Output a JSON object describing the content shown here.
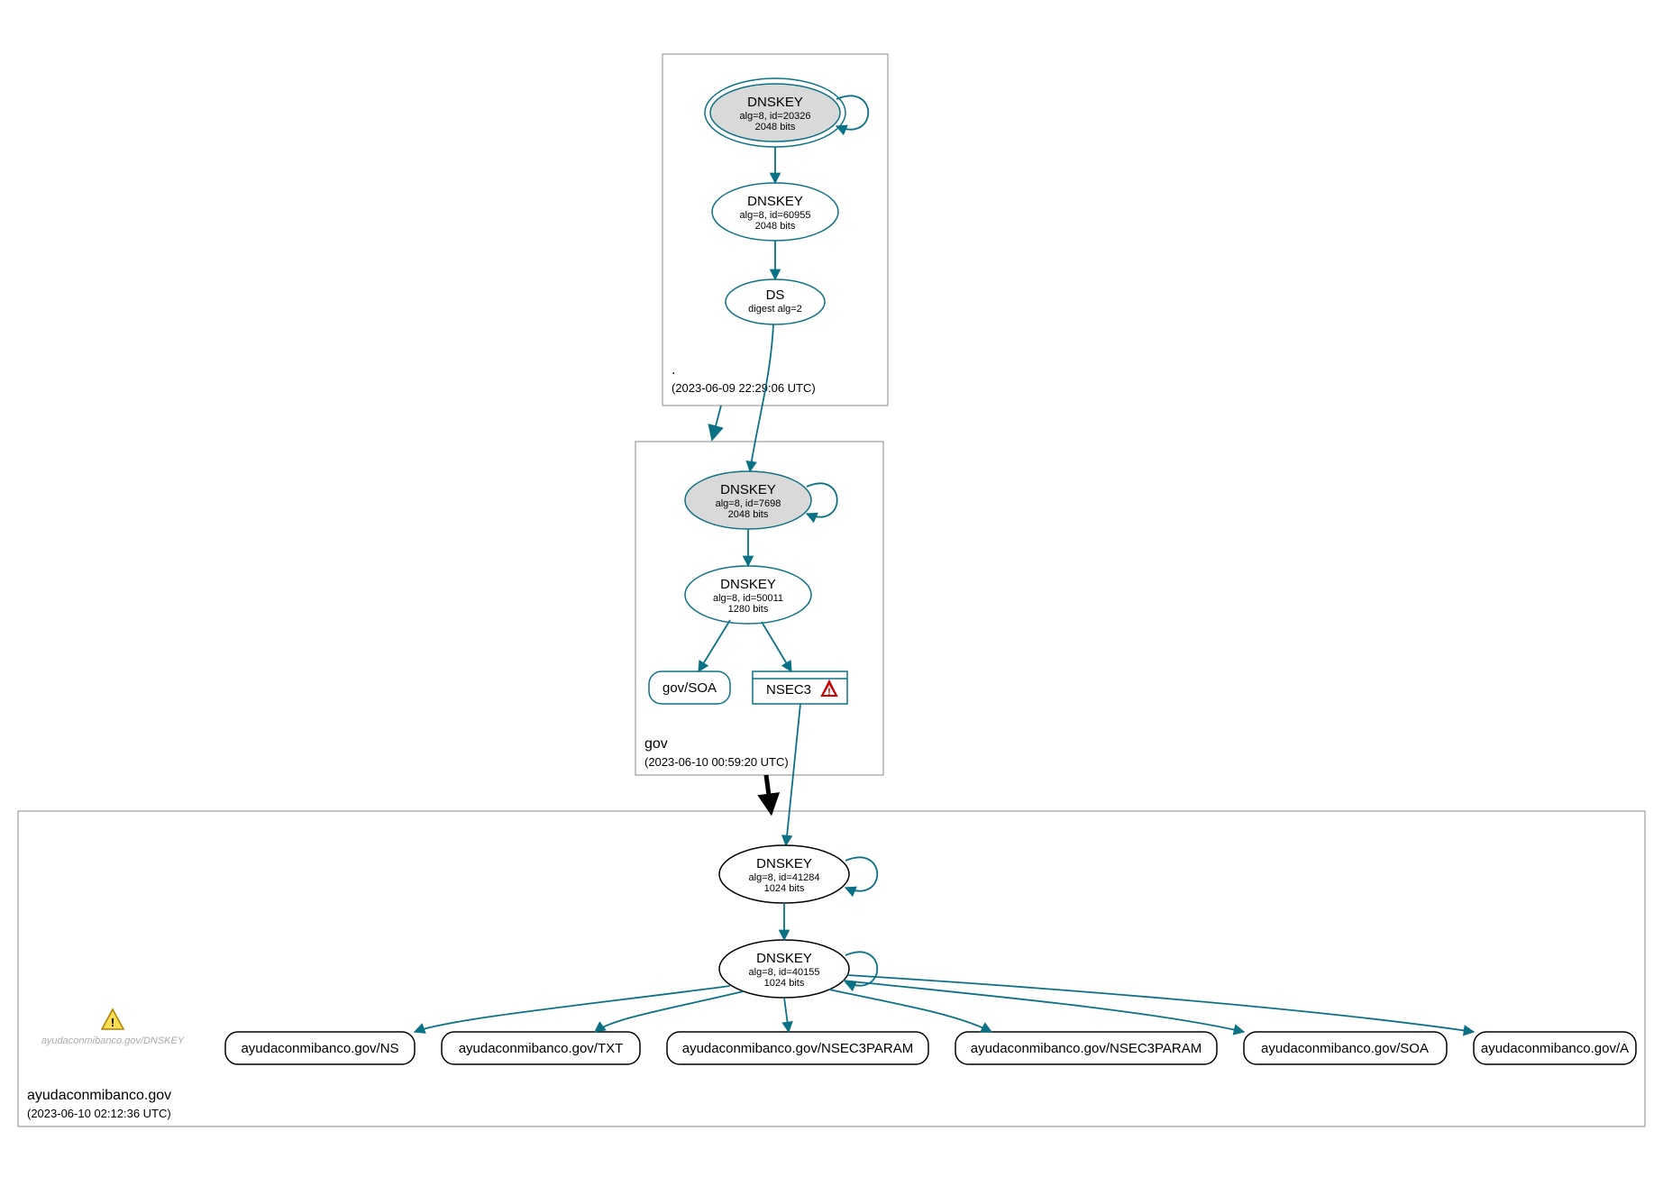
{
  "zones": {
    "root": {
      "name": ".",
      "timestamp": "(2023-06-09 22:29:06 UTC)"
    },
    "gov": {
      "name": "gov",
      "timestamp": "(2023-06-10 00:59:20 UTC)"
    },
    "domain": {
      "name": "ayudaconmibanco.gov",
      "timestamp": "(2023-06-10 02:12:36 UTC)"
    }
  },
  "nodes": {
    "root_ksk": {
      "title": "DNSKEY",
      "line2": "alg=8, id=20326",
      "line3": "2048 bits"
    },
    "root_zsk": {
      "title": "DNSKEY",
      "line2": "alg=8, id=60955",
      "line3": "2048 bits"
    },
    "root_ds": {
      "title": "DS",
      "line2": "digest alg=2"
    },
    "gov_ksk": {
      "title": "DNSKEY",
      "line2": "alg=8, id=7698",
      "line3": "2048 bits"
    },
    "gov_zsk": {
      "title": "DNSKEY",
      "line2": "alg=8, id=50011",
      "line3": "1280 bits"
    },
    "gov_soa": {
      "label": "gov/SOA"
    },
    "gov_nsec3": {
      "label": "NSEC3"
    },
    "dom_ksk": {
      "title": "DNSKEY",
      "line2": "alg=8, id=41284",
      "line3": "1024 bits"
    },
    "dom_zsk": {
      "title": "DNSKEY",
      "line2": "alg=8, id=40155",
      "line3": "1024 bits"
    },
    "dom_warn": {
      "label": "ayudaconmibanco.gov/DNSKEY"
    },
    "rr_ns": {
      "label": "ayudaconmibanco.gov/NS"
    },
    "rr_txt": {
      "label": "ayudaconmibanco.gov/TXT"
    },
    "rr_n3p1": {
      "label": "ayudaconmibanco.gov/NSEC3PARAM"
    },
    "rr_n3p2": {
      "label": "ayudaconmibanco.gov/NSEC3PARAM"
    },
    "rr_soa": {
      "label": "ayudaconmibanco.gov/SOA"
    },
    "rr_a": {
      "label": "ayudaconmibanco.gov/A"
    }
  }
}
